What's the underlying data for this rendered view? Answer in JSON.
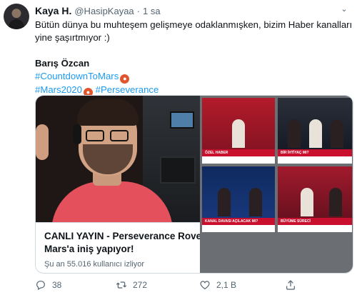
{
  "tweet": {
    "author_name": "Kaya H.",
    "author_handle": "@HasipKayaa",
    "separator": "·",
    "time": "1 sa",
    "text_line1": "Bütün dünya bu muhteşem gelişmeye odaklanmışken, bizim Haber kanalları",
    "text_line2": "yine şaşırtmıyor :)",
    "quoted_name": "Barış Özcan",
    "hashtag1": "#CountdownToMars",
    "hashtag2": "#Mars2020",
    "hashtag3": "#Perseverance"
  },
  "card": {
    "title": "CANLI YAYIN - Perseverance Rover",
    "title2": "Mars'a iniş yapıyor!",
    "subtitle": "Şu an 55.016 kullanıcı izliyor"
  },
  "tv_chyrons": {
    "t1": "ÖZEL HABER",
    "t2": "BİR İHTİYAÇ MI?",
    "t3": "KANAL DAVASI AÇILACAK MI?",
    "t4": "BÜYÜME SÜRECİ"
  },
  "actions": {
    "replies": "38",
    "retweets": "272",
    "likes": "2,1 B"
  },
  "icons": {
    "reply": "reply-icon",
    "retweet": "retweet-icon",
    "like": "heart-icon",
    "share": "share-icon",
    "mars": "mars-emoji-icon"
  },
  "colors": {
    "link": "#1d9bf0",
    "muted": "#536471"
  }
}
